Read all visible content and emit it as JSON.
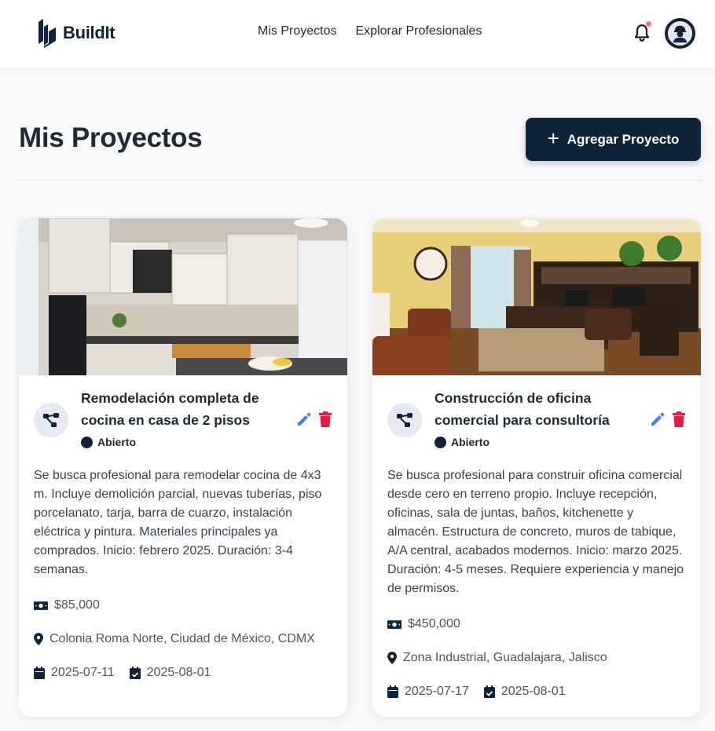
{
  "app": {
    "name": "BuildIt"
  },
  "nav": {
    "links": [
      "Mis Proyectos",
      "Explorar Profesionales"
    ]
  },
  "page": {
    "title": "Mis Proyectos",
    "add_button": "Agregar Proyecto"
  },
  "colors": {
    "primary": "#0f2438",
    "edit": "#3b82f6",
    "delete": "#e11d48",
    "notification": "#f97373"
  },
  "projects": [
    {
      "title": "Remodelación completa de cocina en casa de 2 pisos",
      "status": "Abierto",
      "description": "Se busca profesional para remodelar cocina de 4x3 m. Incluye demolición parcial, nuevas tuberías, piso porcelanato, tarja, barra de cuarzo, instalación eléctrica y pintura. Materiales principales ya comprados. Inicio: febrero 2025. Duración: 3-4 semanas.",
      "budget": "$85,000",
      "location": "Colonia Roma Norte, Ciudad de México, CDMX",
      "start_date": "2025-07-11",
      "end_date": "2025-08-01",
      "image": "kitchen-photo"
    },
    {
      "title": "Construcción de oficina comercial para consultoría",
      "status": "Abierto",
      "description": "Se busca profesional para construir oficina comercial desde cero en terreno propio. Incluye recepción, oficinas, sala de juntas, baños, kitchenette y almacén. Estructura de concreto, muros de tabique, A/A central, acabados modernos. Inicio: marzo 2025. Duración: 4-5 meses. Requiere experiencia y manejo de permisos.",
      "budget": "$450,000",
      "location": "Zona Industrial, Guadalajara, Jalisco",
      "start_date": "2025-07-17",
      "end_date": "2025-08-01",
      "image": "office-photo"
    }
  ]
}
